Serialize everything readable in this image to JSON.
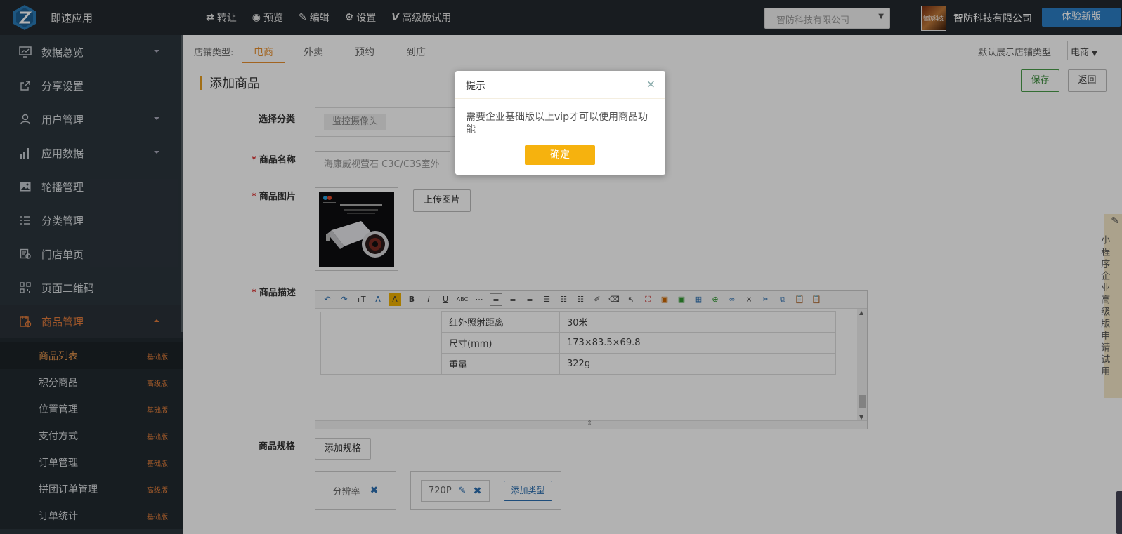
{
  "topbar": {
    "app_name": "即速应用",
    "nav": [
      {
        "icon": "transfer-icon",
        "glyph": "⇄",
        "label": "转让"
      },
      {
        "icon": "preview-icon",
        "glyph": "◉",
        "label": "预览"
      },
      {
        "icon": "edit-icon",
        "glyph": "✎",
        "label": "编辑"
      },
      {
        "icon": "gear-icon",
        "glyph": "⚙",
        "label": "设置"
      },
      {
        "icon": "v-icon",
        "glyph": "V",
        "label": "高级版试用"
      }
    ],
    "company_select": "智防科技有限公司",
    "company_name": "智防科技有限公司",
    "try_new_label": "体验新版"
  },
  "sidebar": {
    "main_items": [
      {
        "label": "数据总览",
        "icon": "monitor-icon",
        "caret": true
      },
      {
        "label": "分享设置",
        "icon": "share-icon",
        "caret": false
      },
      {
        "label": "用户管理",
        "icon": "user-icon",
        "caret": true
      },
      {
        "label": "应用数据",
        "icon": "bar-chart-icon",
        "caret": true
      },
      {
        "label": "轮播管理",
        "icon": "image-icon",
        "caret": false
      },
      {
        "label": "分类管理",
        "icon": "list-icon",
        "caret": false
      },
      {
        "label": "门店单页",
        "icon": "store-icon",
        "caret": false
      },
      {
        "label": "页面二维码",
        "icon": "qrcode-icon",
        "caret": false
      },
      {
        "label": "商品管理",
        "icon": "goods-icon",
        "caret": true
      }
    ],
    "sub_items": [
      {
        "label": "商品列表",
        "tag": "基础版"
      },
      {
        "label": "积分商品",
        "tag": "高级版"
      },
      {
        "label": "位置管理",
        "tag": "基础版"
      },
      {
        "label": "支付方式",
        "tag": "基础版"
      },
      {
        "label": "订单管理",
        "tag": "基础版"
      },
      {
        "label": "拼团订单管理",
        "tag": "高级版"
      },
      {
        "label": "订单统计",
        "tag": "基础版"
      }
    ]
  },
  "shop_bar": {
    "label": "店铺类型:",
    "tabs": [
      "电商",
      "外卖",
      "预约",
      "到店"
    ],
    "default_label": "默认展示店铺类型",
    "default_value": "电商"
  },
  "page": {
    "title": "添加商品",
    "save_label": "保存",
    "back_label": "返回"
  },
  "form": {
    "category_label": "选择分类",
    "category_value": "监控摄像头",
    "name_label": "商品名称",
    "name_value": "海康威视萤石 C3C/C3S室外",
    "image_label": "商品图片",
    "upload_label": "上传图片",
    "desc_label": "商品描述",
    "spec_label": "商品规格",
    "add_spec_label": "添加规格",
    "spec_group_name": "分辨率",
    "spec_value": "720P",
    "add_type_label": "添加类型"
  },
  "spec_table": [
    [
      "红外照射距离",
      "30米"
    ],
    [
      "尺寸(mm)",
      "173×83.5×69.8"
    ],
    [
      "重量",
      "322g"
    ]
  ],
  "side_apply": "小程序企业高级版申请试用",
  "modal": {
    "title": "提示",
    "message": "需要企业基础版以上vip才可以使用商品功能",
    "ok_label": "确定"
  },
  "colors": {
    "topbar": "#23292e",
    "sidebar": "#2c353d",
    "accent_orange": "#e8902e",
    "modal_ok": "#f6b20e",
    "brand_blue": "#2c7fc6"
  }
}
